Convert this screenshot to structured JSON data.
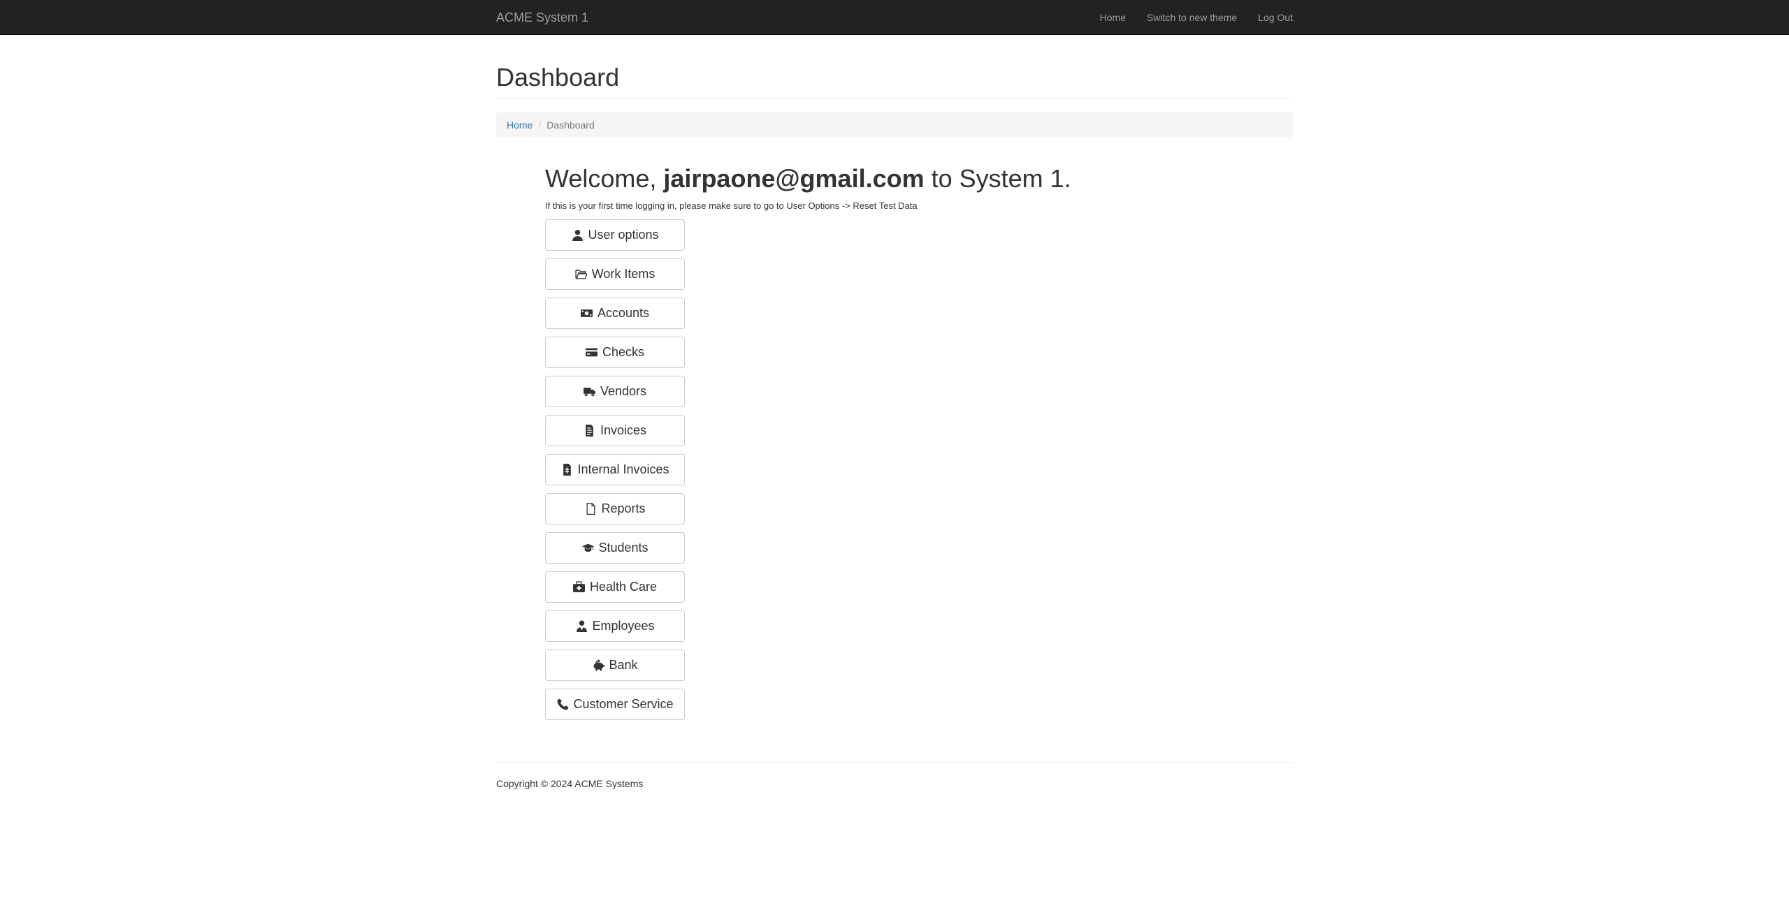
{
  "navbar": {
    "brand": "ACME System 1",
    "links": [
      "Home",
      "Switch to new theme",
      "Log Out"
    ]
  },
  "page": {
    "title": "Dashboard"
  },
  "breadcrumb": {
    "home": "Home",
    "current": "Dashboard"
  },
  "welcome": {
    "prefix": "Welcome,",
    "email": "jairpaone@gmail.com",
    "suffix": "to System 1.",
    "note": "If this is your first time logging in, please make sure to go to User Options -> Reset Test Data"
  },
  "menu": [
    {
      "label": "User options",
      "icon": "user-icon"
    },
    {
      "label": "Work Items",
      "icon": "folder-open-icon"
    },
    {
      "label": "Accounts",
      "icon": "money-bill-icon"
    },
    {
      "label": "Checks",
      "icon": "credit-card-icon"
    },
    {
      "label": "Vendors",
      "icon": "truck-icon"
    },
    {
      "label": "Invoices",
      "icon": "file-invoice-icon"
    },
    {
      "label": "Internal Invoices",
      "icon": "file-invoice-dollar-icon"
    },
    {
      "label": "Reports",
      "icon": "file-icon"
    },
    {
      "label": "Students",
      "icon": "graduation-cap-icon"
    },
    {
      "label": "Health Care",
      "icon": "medkit-icon"
    },
    {
      "label": "Employees",
      "icon": "user-tie-icon"
    },
    {
      "label": "Bank",
      "icon": "piggy-bank-icon"
    },
    {
      "label": "Customer Service",
      "icon": "phone-icon"
    }
  ],
  "footer": {
    "copyright": "Copyright © 2024 ACME Systems"
  },
  "colors": {
    "navbar_bg": "#222222",
    "nav_text": "#9d9d9d",
    "link": "#337ab7"
  }
}
